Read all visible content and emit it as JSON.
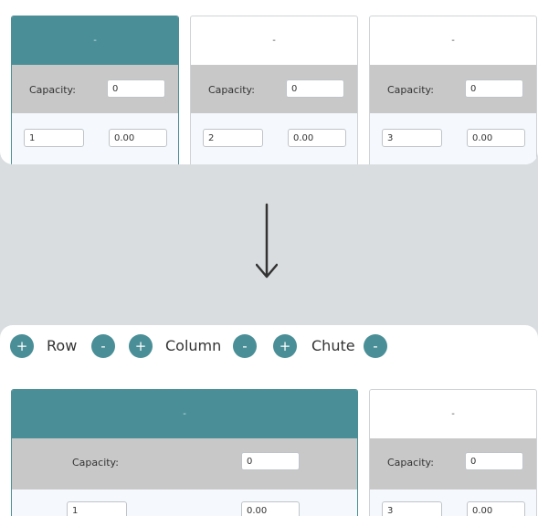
{
  "top": {
    "chutes": [
      {
        "header": "-",
        "capacity_label": "Capacity:",
        "capacity": "0",
        "number": "1",
        "value": "0.00"
      },
      {
        "header": "-",
        "capacity_label": "Capacity:",
        "capacity": "0",
        "number": "2",
        "value": "0.00"
      },
      {
        "header": "-",
        "capacity_label": "Capacity:",
        "capacity": "0",
        "number": "3",
        "value": "0.00"
      }
    ]
  },
  "toolbar": {
    "plus": "+",
    "minus": "-",
    "row_label": "Row",
    "column_label": "Column",
    "chute_label": "Chute"
  },
  "bottom": {
    "chutes": [
      {
        "header": "-",
        "capacity_label": "Capacity:",
        "capacity": "0",
        "number": "1",
        "value": "0.00"
      },
      {
        "header": "-",
        "capacity_label": "Capacity:",
        "capacity": "0",
        "number": "3",
        "value": "0.00"
      }
    ]
  },
  "colors": {
    "accent": "#4a8f97",
    "background": "#dadde0"
  },
  "icons": {
    "arrow": "arrow-down-icon"
  }
}
